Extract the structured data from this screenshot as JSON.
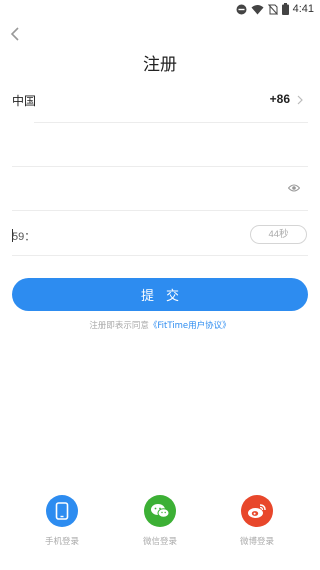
{
  "status_bar": {
    "time": "4:41",
    "icons": [
      "do-not-disturb-icon",
      "wifi-icon",
      "no-sim-icon",
      "battery-icon"
    ]
  },
  "header": {
    "back_icon": "chevron-left-icon",
    "title": "注册"
  },
  "country": {
    "label": "中国",
    "code": "+86"
  },
  "phone_field": {
    "value": "",
    "placeholder": ""
  },
  "password_field": {
    "value": "",
    "placeholder": ""
  },
  "code_field": {
    "value": "59：",
    "placeholder": ""
  },
  "countdown_label": "44秒",
  "submit_label": "提交",
  "agreement": {
    "prefix": "注册即表示同意",
    "link": "《FitTime用户协议》"
  },
  "login_options": [
    {
      "label": "手机登录",
      "icon": "phone-icon",
      "color": "#2d8cf0"
    },
    {
      "label": "微信登录",
      "icon": "wechat-icon",
      "color": "#3cb035"
    },
    {
      "label": "微博登录",
      "icon": "weibo-icon",
      "color": "#e8472b"
    }
  ],
  "colors": {
    "accent": "#2d8cf0",
    "divider": "#ececec",
    "hint_text": "#aaaaaa"
  }
}
